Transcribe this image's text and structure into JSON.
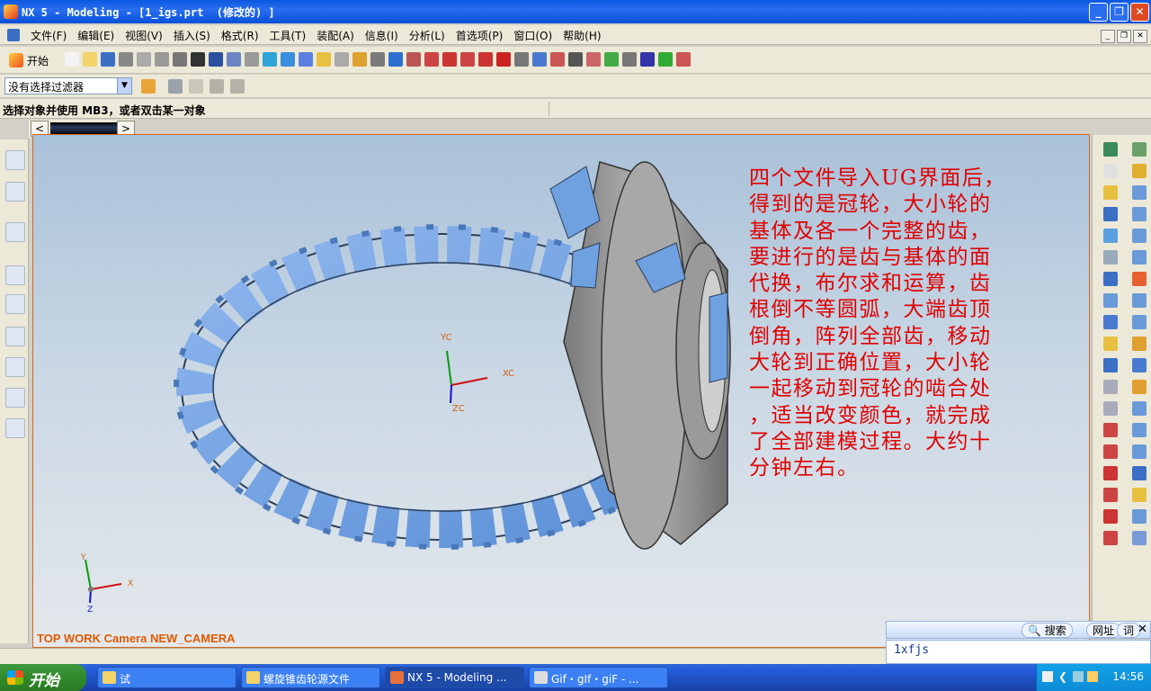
{
  "window": {
    "title": "NX 5 - Modeling - [1_igs.prt  (修改的) ]"
  },
  "menu": [
    "文件(F)",
    "编辑(E)",
    "视图(V)",
    "插入(S)",
    "格式(R)",
    "工具(T)",
    "装配(A)",
    "信息(I)",
    "分析(L)",
    "首选项(P)",
    "窗口(O)",
    "帮助(H)"
  ],
  "toolbar": {
    "start_label": "开始"
  },
  "filter": {
    "value": "没有选择过滤器"
  },
  "cue": {
    "text": "选择对象并使用 MB3，或者双击某一对象"
  },
  "viewport": {
    "camera_label": "TOP WORK Camera NEW_CAMERA",
    "wcs": {
      "x": "XC",
      "y": "YC",
      "z": "ZC"
    },
    "abs": {
      "x": "X",
      "y": "Y",
      "z": "Z"
    },
    "annotation_lines": [
      "四个文件导入UG界面后，",
      "得到的是冠轮，大小轮的",
      "基体及各一个完整的齿，",
      "要进行的是齿与基体的面",
      "代换，布尔求和运算，齿",
      "根倒不等圆弧，大端齿顶",
      "倒角，阵列全部齿，移动",
      "大轮到正确位置，大小轮",
      "一起移动到冠轮的啮合处",
      "，适当改变颜色，就完成",
      "了全部建模过程。大约十",
      "分钟左右。"
    ]
  },
  "ime": {
    "search_label": "搜索",
    "addr_label": "网址",
    "word_label": "词",
    "input_value": "1xfjs"
  },
  "taskbar": {
    "start_label": "开始",
    "items": [
      "试",
      "螺旋锥齿轮源文件",
      "NX 5 - Modeling ...",
      "Gif・gIf・giF - ..."
    ],
    "clock": "14:56"
  }
}
